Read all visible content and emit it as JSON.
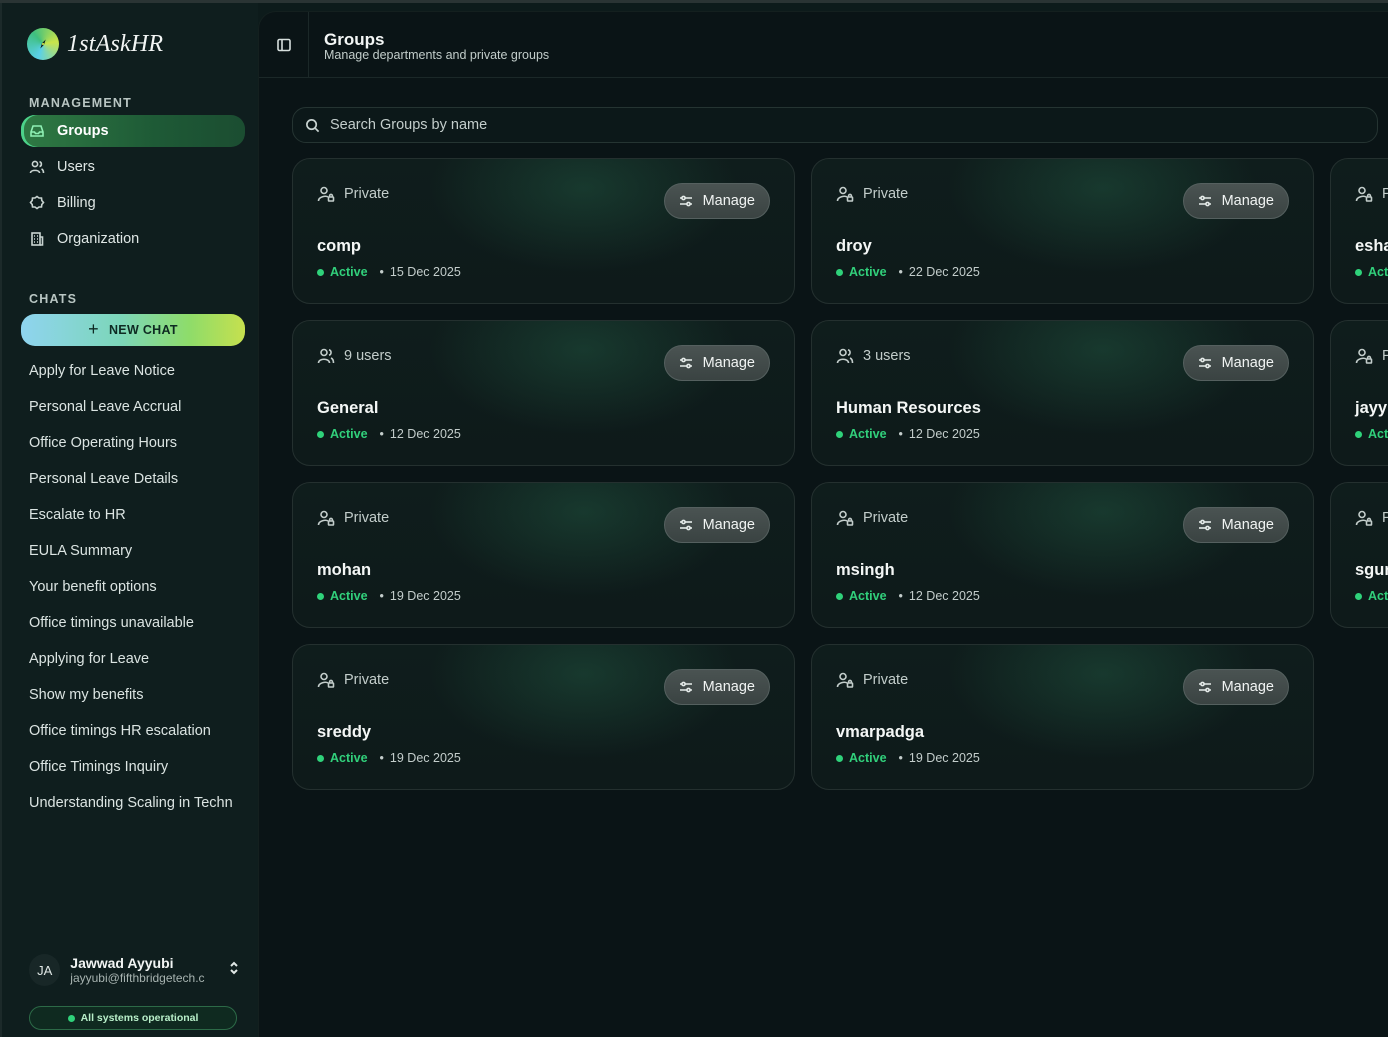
{
  "brand": {
    "name": "1stAskHR"
  },
  "sidebar": {
    "management_label": "MANAGEMENT",
    "nav": [
      {
        "label": "Groups",
        "icon": "inbox-icon",
        "active": true
      },
      {
        "label": "Users",
        "icon": "users-icon",
        "active": false
      },
      {
        "label": "Billing",
        "icon": "badge-icon",
        "active": false
      },
      {
        "label": "Organization",
        "icon": "building-icon",
        "active": false
      }
    ],
    "chats_label": "CHATS",
    "new_chat_label": "NEW CHAT",
    "chats": [
      "Apply for Leave Notice",
      "Personal Leave Accrual",
      "Office Operating Hours",
      "Personal Leave Details",
      "Escalate to HR",
      "EULA Summary",
      "Your benefit options",
      "Office timings unavailable",
      "Applying for Leave",
      "Show my benefits",
      "Office timings HR escalation",
      "Office Timings Inquiry",
      "Understanding Scaling in Techn"
    ],
    "user": {
      "initials": "JA",
      "name": "Jawwad Ayyubi",
      "email": "jayyubi@fifthbridgetech.c"
    },
    "system_status": "All systems operational"
  },
  "header": {
    "title": "Groups",
    "subtitle": "Manage departments and private groups"
  },
  "search": {
    "placeholder": "Search Groups by name"
  },
  "manage_label": "Manage",
  "groups": [
    {
      "type": "Private",
      "type_icon": "user-lock-icon",
      "name": "comp",
      "status": "Active",
      "date": "15 Dec 2025"
    },
    {
      "type": "Private",
      "type_icon": "user-lock-icon",
      "name": "droy",
      "status": "Active",
      "date": "22 Dec 2025"
    },
    {
      "type": "P",
      "type_icon": "user-lock-icon",
      "name": "esha",
      "status": "Acti",
      "date": ""
    },
    {
      "type": "9 users",
      "type_icon": "users-icon",
      "name": "General",
      "status": "Active",
      "date": "12 Dec 2025"
    },
    {
      "type": "3 users",
      "type_icon": "users-icon",
      "name": "Human Resources",
      "status": "Active",
      "date": "12 Dec 2025"
    },
    {
      "type": "P",
      "type_icon": "user-lock-icon",
      "name": "jayyu",
      "status": "Acti",
      "date": ""
    },
    {
      "type": "Private",
      "type_icon": "user-lock-icon",
      "name": "mohan",
      "status": "Active",
      "date": "19 Dec 2025"
    },
    {
      "type": "Private",
      "type_icon": "user-lock-icon",
      "name": "msingh",
      "status": "Active",
      "date": "12 Dec 2025"
    },
    {
      "type": "P",
      "type_icon": "user-lock-icon",
      "name": "sgur",
      "status": "Acti",
      "date": ""
    },
    {
      "type": "Private",
      "type_icon": "user-lock-icon",
      "name": "sreddy",
      "status": "Active",
      "date": "19 Dec 2025"
    },
    {
      "type": "Private",
      "type_icon": "user-lock-icon",
      "name": "vmarpadga",
      "status": "Active",
      "date": "19 Dec 2025"
    }
  ],
  "colors": {
    "accent_green": "#31d07b",
    "background": "#0a1416",
    "sidebar": "#0f1e1e"
  }
}
